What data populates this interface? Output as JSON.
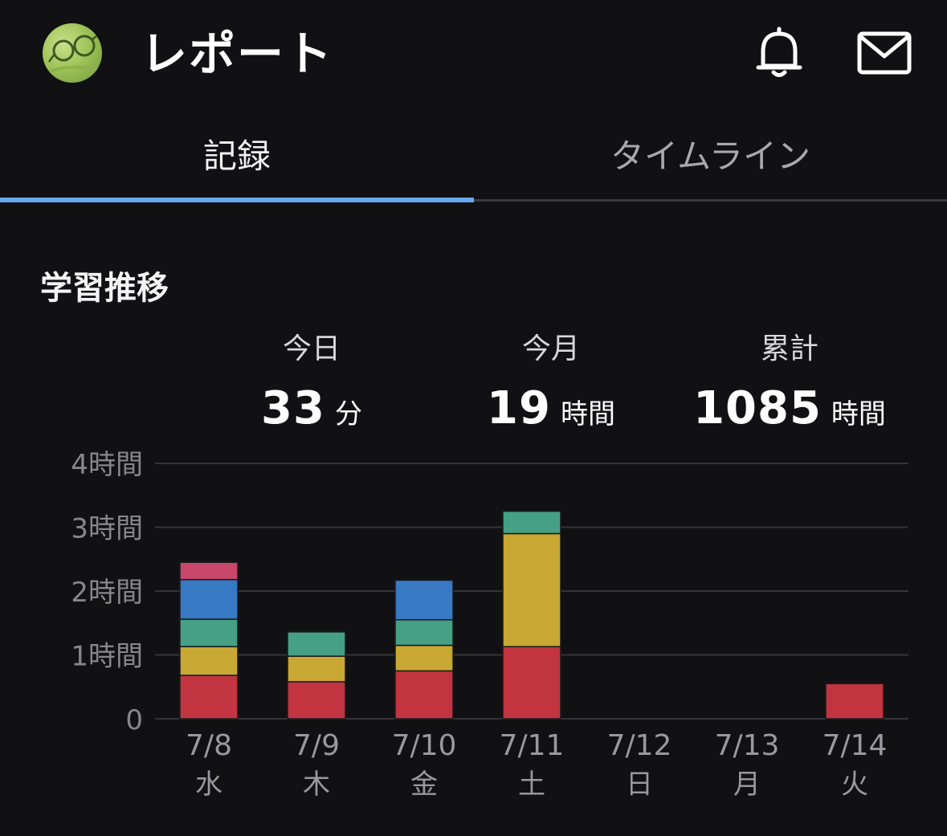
{
  "header": {
    "title": "レポート",
    "avatar_icon": "avatar-glasses-image",
    "bell_icon": "bell-icon",
    "mail_icon": "mail-icon"
  },
  "tabs": [
    {
      "label": "記録",
      "active": true
    },
    {
      "label": "タイムライン",
      "active": false
    }
  ],
  "section": {
    "title": "学習推移"
  },
  "stats": {
    "today": {
      "label": "今日",
      "value": "33",
      "unit": "分"
    },
    "month": {
      "label": "今月",
      "value": "19",
      "unit": "時間"
    },
    "total": {
      "label": "累計",
      "value": "1085",
      "unit": "時間"
    }
  },
  "colors": {
    "background": "#111113",
    "accent": "#66abef",
    "red": "#c23540",
    "yellow": "#c9a733",
    "green": "#45a085",
    "blue": "#3879c4",
    "pink": "#c8476b"
  },
  "chart_data": {
    "type": "bar",
    "stacked": true,
    "grid": true,
    "ylim": [
      0,
      4
    ],
    "yticks": [
      {
        "value": 0,
        "label": "0"
      },
      {
        "value": 1,
        "label": "1時間"
      },
      {
        "value": 2,
        "label": "2時間"
      },
      {
        "value": 3,
        "label": "3時間"
      },
      {
        "value": 4,
        "label": "4時間"
      }
    ],
    "categories": [
      "7/8",
      "7/9",
      "7/10",
      "7/11",
      "7/12",
      "7/13",
      "7/14"
    ],
    "weekdays": [
      "水",
      "木",
      "金",
      "土",
      "日",
      "月",
      "火"
    ],
    "series": [
      {
        "color": "#c23540",
        "values": [
          0.68,
          0.58,
          0.75,
          1.13,
          0,
          0,
          0.55
        ]
      },
      {
        "color": "#c9a733",
        "values": [
          0.45,
          0.4,
          0.4,
          1.77,
          0,
          0,
          0
        ]
      },
      {
        "color": "#45a085",
        "values": [
          0.43,
          0.38,
          0.4,
          0.35,
          0,
          0,
          0
        ]
      },
      {
        "color": "#3879c4",
        "values": [
          0.62,
          0,
          0.62,
          0,
          0,
          0,
          0
        ]
      },
      {
        "color": "#c8476b",
        "values": [
          0.27,
          0,
          0,
          0,
          0,
          0,
          0
        ]
      }
    ]
  }
}
